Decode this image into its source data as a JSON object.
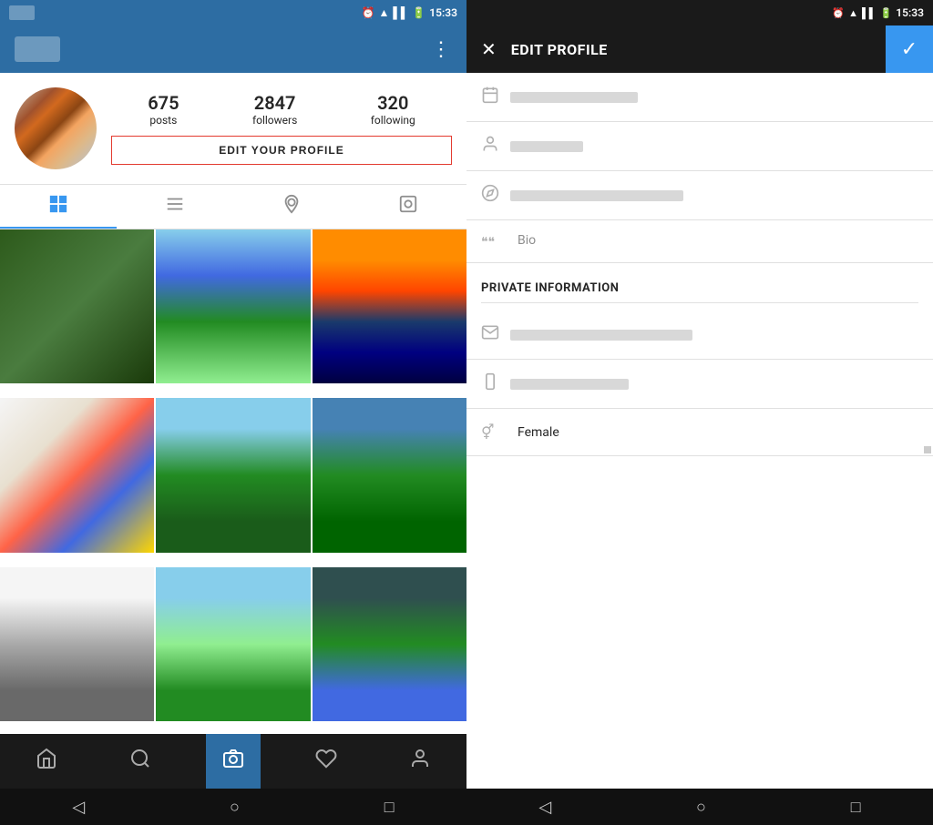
{
  "left": {
    "statusBar": {
      "time": "15:33"
    },
    "stats": {
      "posts": "675",
      "postsLabel": "posts",
      "followers": "2847",
      "followersLabel": "followers",
      "following": "320",
      "followingLabel": "following"
    },
    "editButton": "EDIT YOUR PROFILE",
    "tabs": [
      {
        "name": "grid",
        "icon": "⊞",
        "active": true
      },
      {
        "name": "list",
        "icon": "☰"
      },
      {
        "name": "tagged",
        "icon": "◎"
      },
      {
        "name": "tagged-photo",
        "icon": "⊡"
      }
    ],
    "bottomNav": [
      {
        "name": "home",
        "icon": "⌂",
        "active": false
      },
      {
        "name": "search",
        "icon": "⌕",
        "active": false
      },
      {
        "name": "camera",
        "icon": "◎",
        "active": true
      },
      {
        "name": "heart",
        "icon": "♥",
        "active": false
      },
      {
        "name": "profile",
        "icon": "👤",
        "active": false
      }
    ],
    "systemBar": {
      "back": "◁",
      "home": "○",
      "recent": "□"
    }
  },
  "right": {
    "statusBar": {
      "time": "15:33"
    },
    "header": {
      "closeIcon": "✕",
      "title": "EDIT PROFILE",
      "checkIcon": "✓"
    },
    "fields": {
      "calendarIcon": "📅",
      "personIcon": "👤",
      "compassIcon": "🧭",
      "bioLabel": "Bio",
      "bioIcon": "❝❝"
    },
    "privateSection": {
      "title": "PRIVATE INFORMATION",
      "emailIcon": "✉",
      "phoneIcon": "📱",
      "genderIcon": "⚥",
      "genderValue": "Female"
    },
    "systemBar": {
      "back": "◁",
      "home": "○",
      "recent": "□"
    }
  }
}
